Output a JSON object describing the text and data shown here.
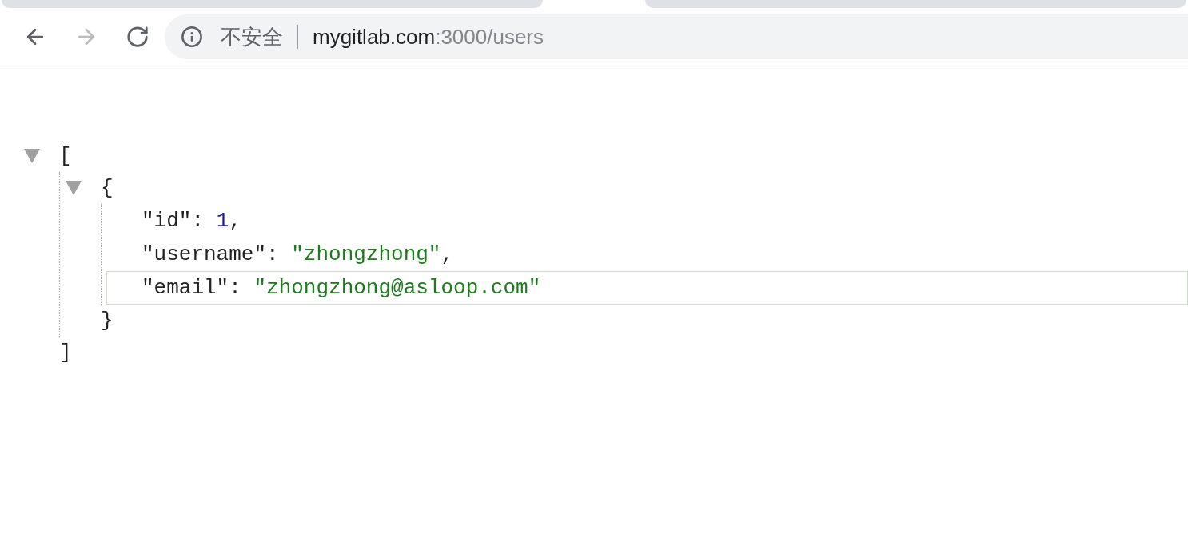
{
  "nav_buttons": [
    {
      "kind": "back",
      "disabled": false
    },
    {
      "kind": "forward",
      "disabled": true
    },
    {
      "kind": "reload",
      "disabled": false
    }
  ],
  "address_bar": {
    "security": "不安全",
    "host": "mygitlab.com",
    "path": ":3000/users"
  },
  "json_tree": {
    "open": "[",
    "close": "]",
    "expanded": true,
    "children": [
      {
        "open": "{",
        "close": "}",
        "expanded": true,
        "children": [
          {
            "key": "\"id\"",
            "colon": ":",
            "value": "1",
            "kind": "number",
            "comma": ",",
            "highlighted": false
          },
          {
            "key": "\"username\"",
            "colon": ":",
            "value": "\"zhongzhong\"",
            "kind": "string",
            "comma": ",",
            "highlighted": false
          },
          {
            "key": "\"email\"",
            "colon": ":",
            "value": "\"zhongzhong@asloop.com\"",
            "kind": "string",
            "highlighted": true
          }
        ]
      }
    ]
  }
}
